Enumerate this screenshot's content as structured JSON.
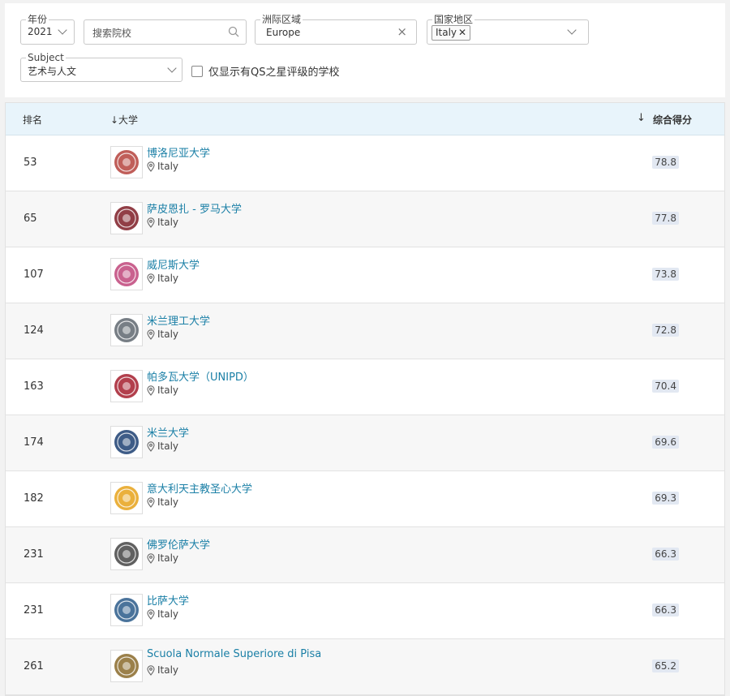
{
  "filters": {
    "year": {
      "label": "年份",
      "value": "2021"
    },
    "search": {
      "placeholder": "搜索院校"
    },
    "region": {
      "label": "洲际区域",
      "value": "Europe"
    },
    "country": {
      "label": "国家地区",
      "chip": "Italy"
    },
    "subject": {
      "label": "Subject",
      "value": "艺术与人文"
    },
    "qs_stars_checkbox": {
      "label": "仅显示有QS之星评级的学校",
      "checked": false
    }
  },
  "table": {
    "headers": {
      "rank": "排名",
      "university": "↓大学",
      "score": "综合得分"
    },
    "rows": [
      {
        "rank": "53",
        "name": "博洛尼亚大学",
        "location": "Italy",
        "score": "78.8",
        "logo": "bologna-seal-icon",
        "logo_color": "#b5423c"
      },
      {
        "rank": "65",
        "name": "萨皮恩扎 - 罗马大学",
        "location": "Italy",
        "score": "77.8",
        "logo": "sapienza-seal-icon",
        "logo_color": "#7e1c26"
      },
      {
        "rank": "107",
        "name": "威尼斯大学",
        "location": "Italy",
        "score": "73.8",
        "logo": "venice-logo-icon",
        "logo_color": "#c0457a"
      },
      {
        "rank": "124",
        "name": "米兰理工大学",
        "location": "Italy",
        "score": "72.8",
        "logo": "polimi-seal-icon",
        "logo_color": "#5f6770"
      },
      {
        "rank": "163",
        "name": "帕多瓦大学（UNIPD）",
        "location": "Italy",
        "score": "70.4",
        "logo": "padova-seal-icon",
        "logo_color": "#a51d2d"
      },
      {
        "rank": "174",
        "name": "米兰大学",
        "location": "Italy",
        "score": "69.6",
        "logo": "milano-logo-icon",
        "logo_color": "#1c3f72"
      },
      {
        "rank": "182",
        "name": "意大利天主教圣心大学",
        "location": "Italy",
        "score": "69.3",
        "logo": "cattolica-seal-icon",
        "logo_color": "#e6a21a"
      },
      {
        "rank": "231",
        "name": "佛罗伦萨大学",
        "location": "Italy",
        "score": "66.3",
        "logo": "firenze-seal-icon",
        "logo_color": "#444444"
      },
      {
        "rank": "231",
        "name": "比萨大学",
        "location": "Italy",
        "score": "66.3",
        "logo": "pisa-logo-icon",
        "logo_color": "#2a5a8a"
      },
      {
        "rank": "261",
        "name": "Scuola Normale Superiore di Pisa",
        "location": "Italy",
        "score": "65.2",
        "logo": "sns-crest-icon",
        "logo_color": "#8a6a2a"
      }
    ]
  },
  "colors": {
    "link": "#1a7fa6",
    "header_bg": "#e8f4fb",
    "score_bg": "#e2e8f2"
  }
}
